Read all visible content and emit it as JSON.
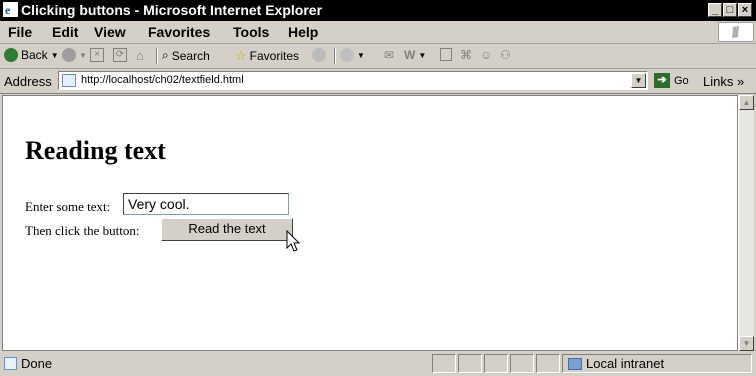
{
  "window": {
    "title": "Clicking buttons - Microsoft Internet Explorer"
  },
  "menu": [
    "File",
    "Edit",
    "View",
    "Favorites",
    "Tools",
    "Help"
  ],
  "toolbar": {
    "back_label": "Back",
    "search_label": "Search",
    "favorites_label": "Favorites"
  },
  "address": {
    "label": "Address",
    "url": "http://localhost/ch02/textfield.html",
    "go_label": "Go",
    "links_label": "Links »"
  },
  "page": {
    "heading": "Reading text",
    "text_label": "Enter some text:",
    "text_value": "Very cool.",
    "button_label_prefix": "Then click the button:",
    "button_text": "Read the text"
  },
  "status": {
    "text": "Done",
    "zone": "Local intranet"
  }
}
